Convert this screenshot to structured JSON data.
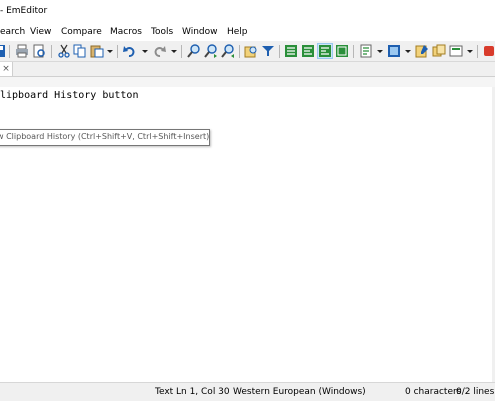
{
  "window": {
    "title": "- EmEditor"
  },
  "menu": [
    "earch",
    "View",
    "Compare",
    "Macros",
    "Tools",
    "Window",
    "Help"
  ],
  "toolbar": {
    "icons": [
      "save-icon",
      "print-icon",
      "print-preview-icon",
      "cut-icon",
      "copy-icon",
      "paste-icon",
      "undo-icon",
      "redo-icon",
      "find-icon",
      "find-next-icon",
      "find-previous-icon",
      "find-in-files-icon",
      "filter-icon",
      "wrap-none-icon",
      "wrap-by-chars-icon",
      "wrap-by-window-icon",
      "wrap-by-page-icon",
      "properties-icon",
      "marker-icon",
      "clipboard-history-icon",
      "outline-icon",
      "macro-icon",
      "record-icon"
    ]
  },
  "tab": {
    "close_glyph": "×"
  },
  "editor": {
    "line1": "lipboard History button"
  },
  "tooltip": {
    "text": "w Clipboard History (Ctrl+Shift+V, Ctrl+Shift+Insert)"
  },
  "status": {
    "mode": "Text",
    "position": "Ln 1, Col 30",
    "encoding": "Western European (Windows)",
    "chars": "0 characters",
    "lines": "0/2 lines"
  },
  "colors": {
    "accent": "#1e5fb0",
    "pressed": "#cce4f7",
    "record": "#d83b2b"
  }
}
